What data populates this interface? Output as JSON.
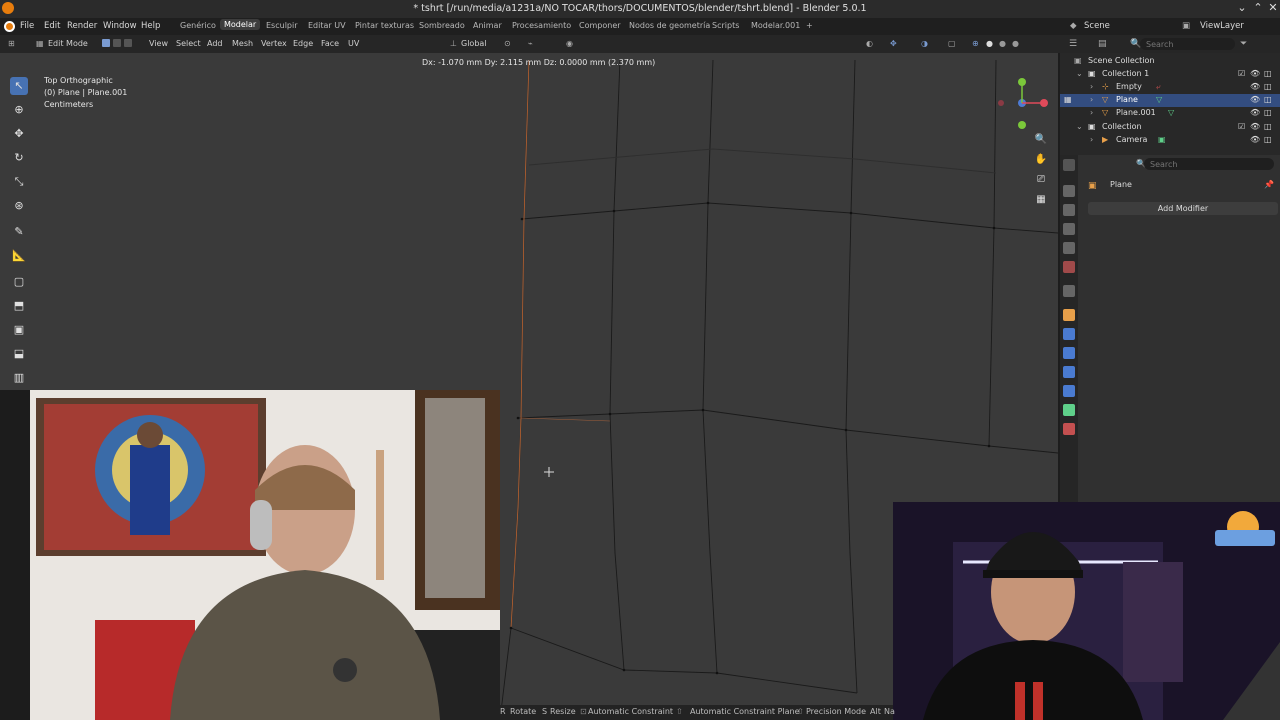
{
  "window": {
    "title": "* tshrt [/run/media/a1231a/NO TOCAR/thors/DOCUMENTOS/blender/tshrt.blend] - Blender 5.0.1"
  },
  "menu": {
    "items": [
      "File",
      "Edit",
      "Render",
      "Window",
      "Help"
    ],
    "workspaces": [
      "Genérico",
      "Modelar",
      "Esculpir",
      "Editar UV",
      "Pintar texturas",
      "Sombreado",
      "Animar",
      "Procesamiento",
      "Componer",
      "Nodos de geometría",
      "Scripts",
      "Modelar.001",
      "+"
    ],
    "active_workspace": "Modelar",
    "scene_label": "Scene",
    "viewlayer_label": "ViewLayer"
  },
  "viewport_header": {
    "mode": "Edit Mode",
    "menus": [
      "View",
      "Select",
      "Add",
      "Mesh",
      "Vertex",
      "Edge",
      "Face",
      "UV"
    ],
    "orientation": "Global"
  },
  "viewport": {
    "view_name": "Top Orthographic",
    "object_info": "(0) Plane | Plane.001",
    "units": "Centimeters",
    "transform_hint": "Dx: -1.070 mm   Dy: 2.115 mm   Dz: 0.0000 mm (2.370 mm)"
  },
  "outliner": {
    "search_placeholder": "Search",
    "rows": [
      {
        "label": "Scene Collection"
      },
      {
        "label": "Collection 1"
      },
      {
        "label": "Empty"
      },
      {
        "label": "Plane"
      },
      {
        "label": "Plane.001"
      },
      {
        "label": "Collection"
      },
      {
        "label": "Camera"
      }
    ]
  },
  "properties": {
    "search_placeholder": "Search",
    "object_name": "Plane",
    "add_modifier": "Add Modifier"
  },
  "statusbar": {
    "items": [
      "Rotate",
      "Resize",
      "Automatic Constraint",
      "Automatic Constraint Plane",
      "Precision Mode"
    ],
    "key_rotate": "R",
    "key_resize": "S",
    "key_alt": "Alt",
    "key_alt_suffix": "Na"
  },
  "colors": {
    "accent": "#4772b3",
    "selection": "#334d80",
    "viewport_bg": "#3a3a3a",
    "edge_active": "#e8793a"
  }
}
